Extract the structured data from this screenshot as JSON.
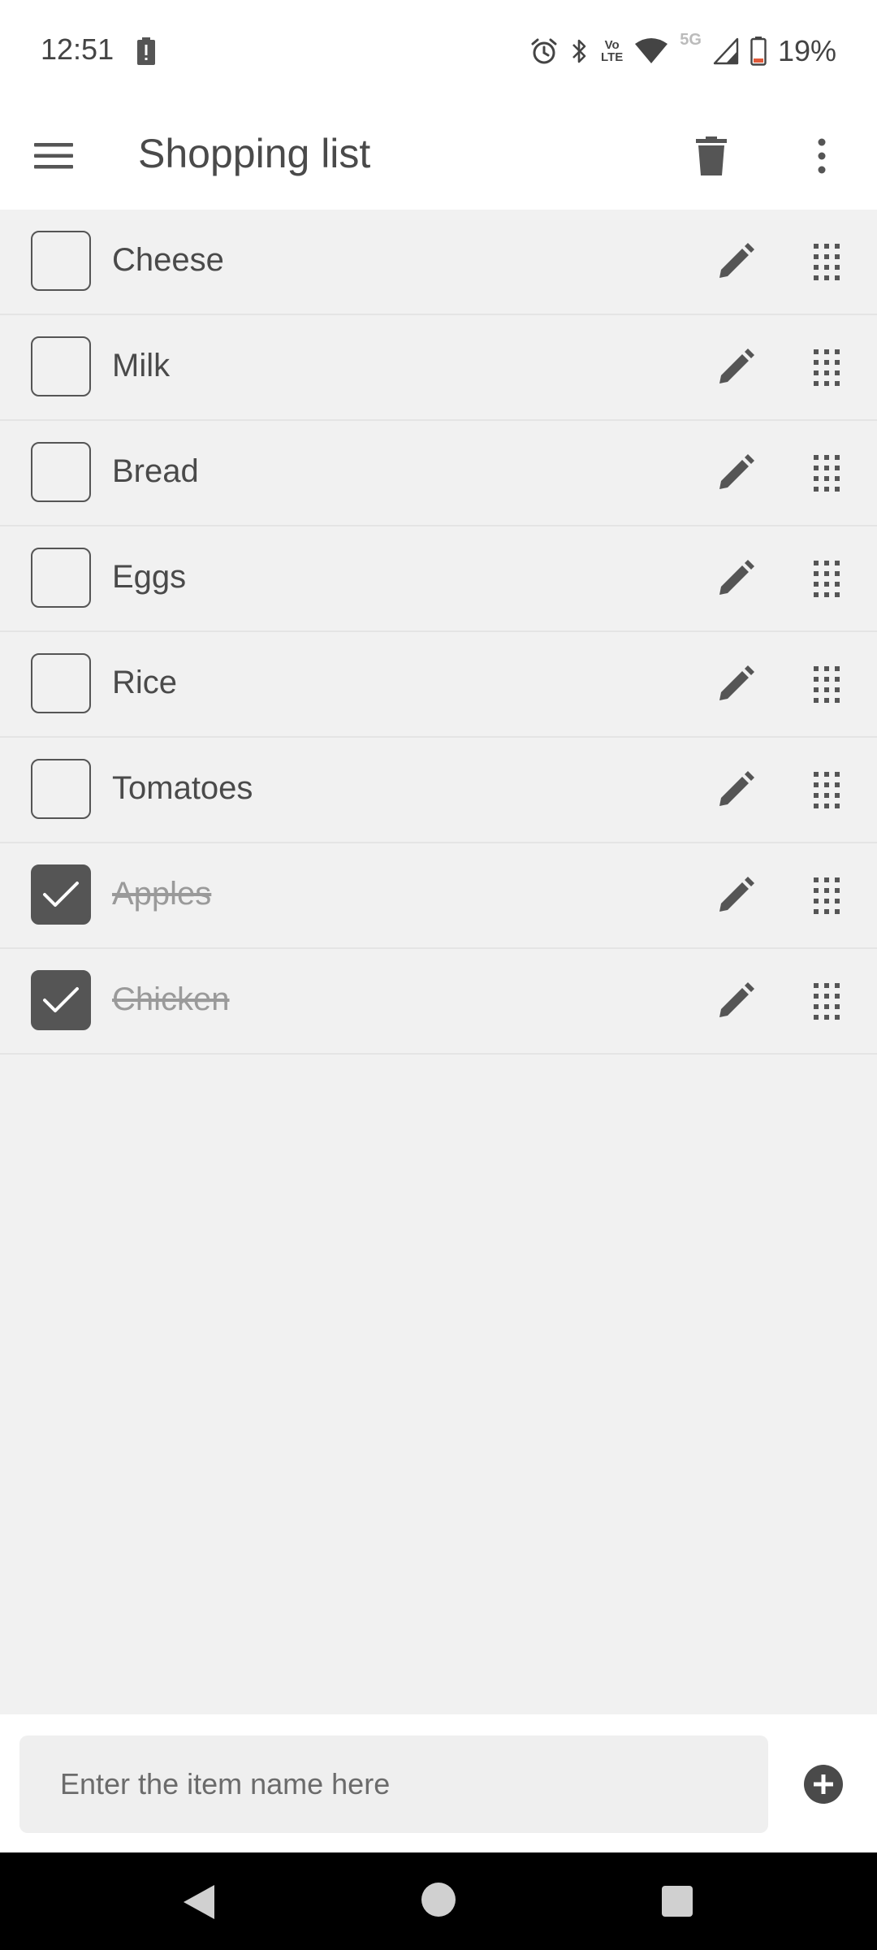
{
  "status_bar": {
    "time": "12:51",
    "battery_percent": "19%",
    "network_label": "5G",
    "volte_label_top": "Vo",
    "volte_label_bottom": "LTE"
  },
  "app_bar": {
    "title": "Shopping list",
    "menu_icon": "hamburger-menu-icon",
    "delete_icon": "trash-icon",
    "more_icon": "more-vertical-icon"
  },
  "items": [
    {
      "label": "Cheese",
      "checked": false
    },
    {
      "label": "Milk",
      "checked": false
    },
    {
      "label": "Bread",
      "checked": false
    },
    {
      "label": "Eggs",
      "checked": false
    },
    {
      "label": "Rice",
      "checked": false
    },
    {
      "label": "Tomatoes",
      "checked": false
    },
    {
      "label": "Apples",
      "checked": true
    },
    {
      "label": "Chicken",
      "checked": true
    }
  ],
  "input": {
    "placeholder": "Enter the item name here",
    "value": ""
  },
  "colors": {
    "accent": "#555555",
    "background": "#f1f1f1",
    "surface": "#ffffff",
    "text": "#4a4a4a",
    "muted_text": "#9a9a9a",
    "battery_low": "#e05a3a"
  }
}
